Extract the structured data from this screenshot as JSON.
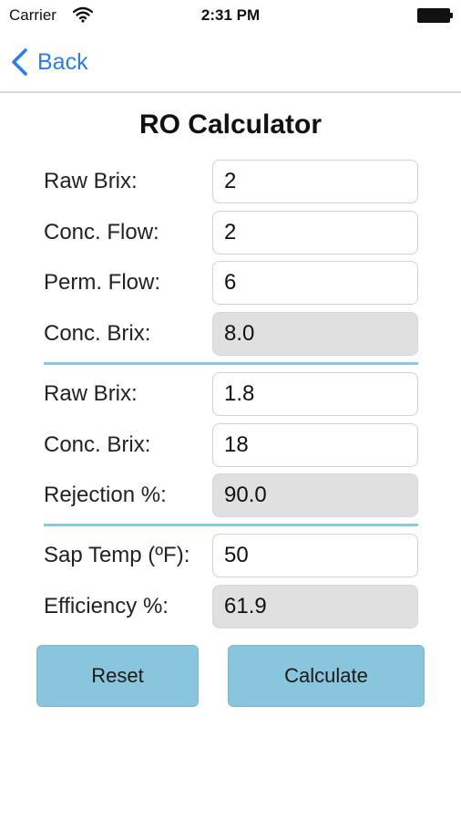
{
  "status_bar": {
    "carrier": "Carrier",
    "time": "2:31 PM"
  },
  "nav": {
    "back_label": "Back",
    "accent_color": "#2b7cf0"
  },
  "title": "RO Calculator",
  "section1": [
    {
      "label": "Raw Brix:",
      "value": "2",
      "editable": true
    },
    {
      "label": "Conc. Flow:",
      "value": "2",
      "editable": true
    },
    {
      "label": "Perm. Flow:",
      "value": "6",
      "editable": true
    },
    {
      "label": "Conc. Brix:",
      "value": "8.0",
      "editable": false
    }
  ],
  "section2": [
    {
      "label": "Raw Brix:",
      "value": "1.8",
      "editable": true
    },
    {
      "label": "Conc. Brix:",
      "value": "18",
      "editable": true
    },
    {
      "label": "Rejection %:",
      "value": "90.0",
      "editable": false
    }
  ],
  "section3": [
    {
      "label": "Sap Temp (ºF):",
      "value": "50",
      "editable": true
    },
    {
      "label": "Efficiency %:",
      "value": "61.9",
      "editable": false
    }
  ],
  "buttons": {
    "reset_label": "Reset",
    "calculate_label": "Calculate",
    "button_color": "#89c5dc"
  }
}
